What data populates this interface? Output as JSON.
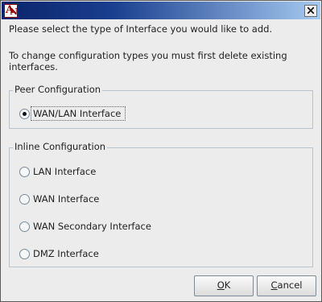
{
  "dialog": {
    "prompt": "Please select the type of Interface you would like to add.",
    "info_line1": "To change configuration types you must first delete existing",
    "info_line2": "interfaces."
  },
  "peer": {
    "legend": "Peer Configuration",
    "options": [
      {
        "label": "WAN/LAN Interface",
        "selected": true
      }
    ]
  },
  "inline": {
    "legend": "Inline Configuration",
    "options": [
      {
        "label": "LAN Interface",
        "selected": false
      },
      {
        "label": "WAN Interface",
        "selected": false
      },
      {
        "label": "WAN Secondary Interface",
        "selected": false
      },
      {
        "label": "DMZ Interface",
        "selected": false
      }
    ]
  },
  "buttons": {
    "ok_mnemonic": "O",
    "ok_rest": "K",
    "cancel_mnemonic": "C",
    "cancel_rest": "ancel"
  },
  "colors": {
    "titlebar_start": "#0a246a",
    "titlebar_end": "#a6caf0",
    "dialog_bg": "#ececec"
  },
  "icons": {
    "app": "app-logo-icon",
    "close": "close-icon"
  }
}
